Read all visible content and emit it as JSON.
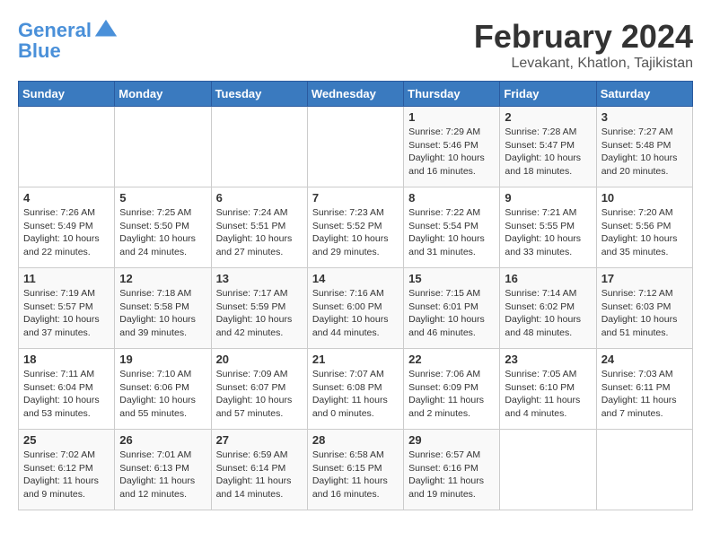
{
  "header": {
    "logo_line1": "General",
    "logo_line2": "Blue",
    "title": "February 2024",
    "subtitle": "Levakant, Khatlon, Tajikistan"
  },
  "days_of_week": [
    "Sunday",
    "Monday",
    "Tuesday",
    "Wednesday",
    "Thursday",
    "Friday",
    "Saturday"
  ],
  "weeks": [
    [
      {
        "day": "",
        "info": ""
      },
      {
        "day": "",
        "info": ""
      },
      {
        "day": "",
        "info": ""
      },
      {
        "day": "",
        "info": ""
      },
      {
        "day": "1",
        "info": "Sunrise: 7:29 AM\nSunset: 5:46 PM\nDaylight: 10 hours\nand 16 minutes."
      },
      {
        "day": "2",
        "info": "Sunrise: 7:28 AM\nSunset: 5:47 PM\nDaylight: 10 hours\nand 18 minutes."
      },
      {
        "day": "3",
        "info": "Sunrise: 7:27 AM\nSunset: 5:48 PM\nDaylight: 10 hours\nand 20 minutes."
      }
    ],
    [
      {
        "day": "4",
        "info": "Sunrise: 7:26 AM\nSunset: 5:49 PM\nDaylight: 10 hours\nand 22 minutes."
      },
      {
        "day": "5",
        "info": "Sunrise: 7:25 AM\nSunset: 5:50 PM\nDaylight: 10 hours\nand 24 minutes."
      },
      {
        "day": "6",
        "info": "Sunrise: 7:24 AM\nSunset: 5:51 PM\nDaylight: 10 hours\nand 27 minutes."
      },
      {
        "day": "7",
        "info": "Sunrise: 7:23 AM\nSunset: 5:52 PM\nDaylight: 10 hours\nand 29 minutes."
      },
      {
        "day": "8",
        "info": "Sunrise: 7:22 AM\nSunset: 5:54 PM\nDaylight: 10 hours\nand 31 minutes."
      },
      {
        "day": "9",
        "info": "Sunrise: 7:21 AM\nSunset: 5:55 PM\nDaylight: 10 hours\nand 33 minutes."
      },
      {
        "day": "10",
        "info": "Sunrise: 7:20 AM\nSunset: 5:56 PM\nDaylight: 10 hours\nand 35 minutes."
      }
    ],
    [
      {
        "day": "11",
        "info": "Sunrise: 7:19 AM\nSunset: 5:57 PM\nDaylight: 10 hours\nand 37 minutes."
      },
      {
        "day": "12",
        "info": "Sunrise: 7:18 AM\nSunset: 5:58 PM\nDaylight: 10 hours\nand 39 minutes."
      },
      {
        "day": "13",
        "info": "Sunrise: 7:17 AM\nSunset: 5:59 PM\nDaylight: 10 hours\nand 42 minutes."
      },
      {
        "day": "14",
        "info": "Sunrise: 7:16 AM\nSunset: 6:00 PM\nDaylight: 10 hours\nand 44 minutes."
      },
      {
        "day": "15",
        "info": "Sunrise: 7:15 AM\nSunset: 6:01 PM\nDaylight: 10 hours\nand 46 minutes."
      },
      {
        "day": "16",
        "info": "Sunrise: 7:14 AM\nSunset: 6:02 PM\nDaylight: 10 hours\nand 48 minutes."
      },
      {
        "day": "17",
        "info": "Sunrise: 7:12 AM\nSunset: 6:03 PM\nDaylight: 10 hours\nand 51 minutes."
      }
    ],
    [
      {
        "day": "18",
        "info": "Sunrise: 7:11 AM\nSunset: 6:04 PM\nDaylight: 10 hours\nand 53 minutes."
      },
      {
        "day": "19",
        "info": "Sunrise: 7:10 AM\nSunset: 6:06 PM\nDaylight: 10 hours\nand 55 minutes."
      },
      {
        "day": "20",
        "info": "Sunrise: 7:09 AM\nSunset: 6:07 PM\nDaylight: 10 hours\nand 57 minutes."
      },
      {
        "day": "21",
        "info": "Sunrise: 7:07 AM\nSunset: 6:08 PM\nDaylight: 11 hours\nand 0 minutes."
      },
      {
        "day": "22",
        "info": "Sunrise: 7:06 AM\nSunset: 6:09 PM\nDaylight: 11 hours\nand 2 minutes."
      },
      {
        "day": "23",
        "info": "Sunrise: 7:05 AM\nSunset: 6:10 PM\nDaylight: 11 hours\nand 4 minutes."
      },
      {
        "day": "24",
        "info": "Sunrise: 7:03 AM\nSunset: 6:11 PM\nDaylight: 11 hours\nand 7 minutes."
      }
    ],
    [
      {
        "day": "25",
        "info": "Sunrise: 7:02 AM\nSunset: 6:12 PM\nDaylight: 11 hours\nand 9 minutes."
      },
      {
        "day": "26",
        "info": "Sunrise: 7:01 AM\nSunset: 6:13 PM\nDaylight: 11 hours\nand 12 minutes."
      },
      {
        "day": "27",
        "info": "Sunrise: 6:59 AM\nSunset: 6:14 PM\nDaylight: 11 hours\nand 14 minutes."
      },
      {
        "day": "28",
        "info": "Sunrise: 6:58 AM\nSunset: 6:15 PM\nDaylight: 11 hours\nand 16 minutes."
      },
      {
        "day": "29",
        "info": "Sunrise: 6:57 AM\nSunset: 6:16 PM\nDaylight: 11 hours\nand 19 minutes."
      },
      {
        "day": "",
        "info": ""
      },
      {
        "day": "",
        "info": ""
      }
    ]
  ]
}
